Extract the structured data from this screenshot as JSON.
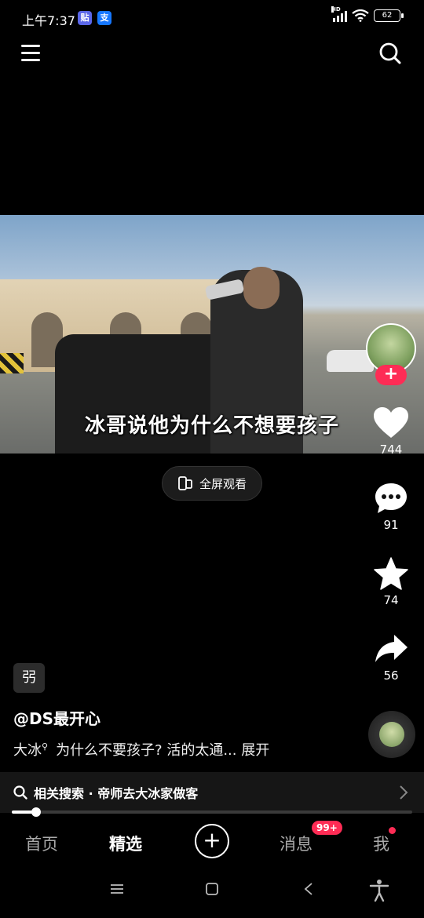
{
  "status_bar": {
    "time": "上午7:37",
    "app_badge_1": "贴",
    "app_badge_2": "支",
    "network": "HD",
    "battery": "62"
  },
  "video": {
    "subtitle": "冰哥说他为什么不想要孩子"
  },
  "fullscreen_button": {
    "label": "全屏观看"
  },
  "actions": {
    "likes": "744",
    "comments": "91",
    "favorites": "74",
    "shares": "56"
  },
  "post": {
    "tag": "弜",
    "author": "@DS最开心",
    "description_prefix": "大冰",
    "description": "为什么不要孩子? 活的太通...",
    "expand": "展开"
  },
  "related_search": {
    "label": "相关搜索 · 帝师去大冰家做客"
  },
  "progress": {
    "fraction": 0.06
  },
  "bottom_nav": {
    "home": "首页",
    "featured": "精选",
    "messages": "消息",
    "messages_badge": "99+",
    "me": "我"
  },
  "colors": {
    "accent": "#fe2c55",
    "background": "#000000"
  },
  "icons": [
    "menu-icon",
    "search-icon",
    "heart-icon",
    "comment-icon",
    "star-icon",
    "share-icon",
    "fullscreen-icon",
    "plus-icon",
    "chevron-right-icon"
  ]
}
